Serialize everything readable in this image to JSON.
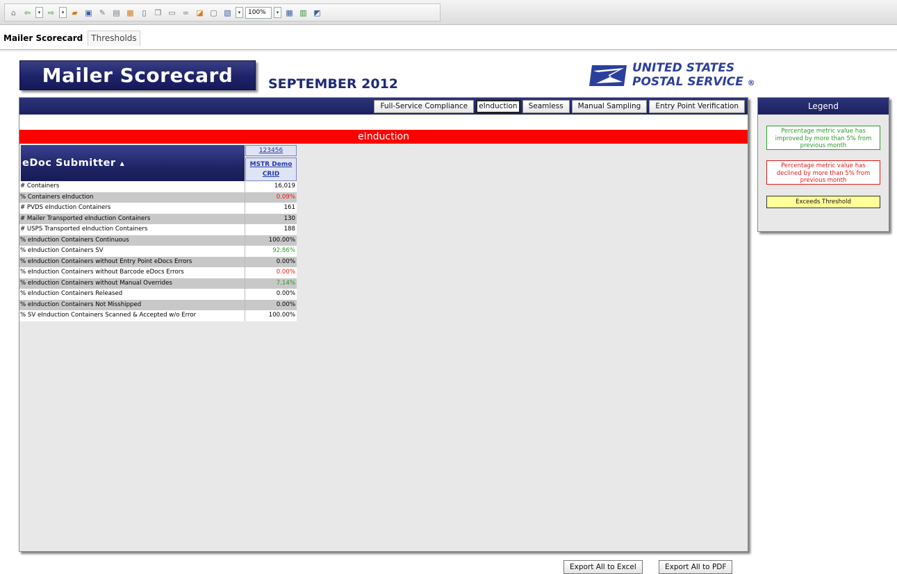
{
  "toolbar": {
    "zoom": "100%"
  },
  "page_tabs": [
    {
      "label": "Mailer Scorecard",
      "active": true
    },
    {
      "label": "Thresholds",
      "active": false
    }
  ],
  "header": {
    "title": "Mailer Scorecard",
    "period": "SEPTEMBER 2012",
    "logo_line1": "UNITED STATES",
    "logo_line2": "POSTAL SERVICE",
    "logo_reg": "®"
  },
  "nav_tabs": [
    {
      "label": "Full-Service Compliance",
      "active": false
    },
    {
      "label": "eInduction",
      "active": true
    },
    {
      "label": "Seamless",
      "active": false
    },
    {
      "label": "Manual Sampling",
      "active": false
    },
    {
      "label": "Entry Point Verification",
      "active": false
    }
  ],
  "section_title": "eInduction",
  "table": {
    "header_label": "eDoc Submitter",
    "sort_indicator": "▲",
    "column_id": "123456",
    "column_name": "MSTR Demo CRID",
    "rows": [
      {
        "label": "# Containers",
        "value": "16,019",
        "status": "normal"
      },
      {
        "label": "% Containers eInduction",
        "value": "0.09%",
        "status": "declined"
      },
      {
        "label": "# PVDS eInduction Containers",
        "value": "161",
        "status": "normal"
      },
      {
        "label": "# Mailer Transported eInduction Containers",
        "value": "130",
        "status": "normal"
      },
      {
        "label": "# USPS Transported eInduction Containers",
        "value": "188",
        "status": "normal"
      },
      {
        "label": "% eInduction Containers Continuous",
        "value": "100.00%",
        "status": "normal"
      },
      {
        "label": "% eInduction Containers SV",
        "value": "92.86%",
        "status": "improved"
      },
      {
        "label": "% eInduction Containers without Entry Point eDocs Errors",
        "value": "0.00%",
        "status": "normal"
      },
      {
        "label": "% eInduction Containers without Barcode eDocs Errors",
        "value": "0.00%",
        "status": "declined"
      },
      {
        "label": "% eInduction Containers without Manual Overrides",
        "value": "7.14%",
        "status": "improved"
      },
      {
        "label": "% eInduction Containers Released",
        "value": "0.00%",
        "status": "normal"
      },
      {
        "label": "% eInduction Containers Not Misshipped",
        "value": "0.00%",
        "status": "normal"
      },
      {
        "label": "% SV eInduction Containers Scanned & Accepted w/o Error",
        "value": "100.00%",
        "status": "normal"
      }
    ]
  },
  "legend": {
    "title": "Legend",
    "improved": "Percentage metric value has improved by more than 5% from previous month",
    "declined": "Percentage metric value has declined by more than 5% from previous month",
    "threshold": "Exceeds Threshold",
    "colors": {
      "improved": "#2a9a2a",
      "declined": "#e01818",
      "threshold": "#ffff99"
    }
  },
  "export": {
    "excel": "Export All to Excel",
    "pdf": "Export All to PDF"
  }
}
